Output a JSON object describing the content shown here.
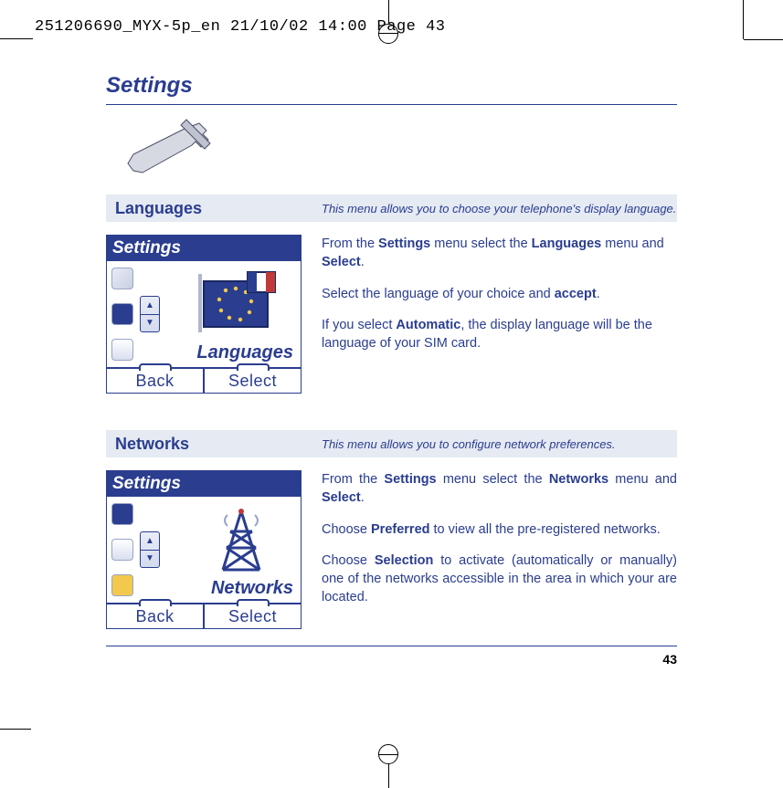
{
  "printer_line": "251206690_MYX-5p_en  21/10/02  14:00  Page 43",
  "page_title": "Settings",
  "page_number": "43",
  "sections": {
    "languages": {
      "title": "Languages",
      "description": "This menu allows you to choose your telephone's display language.",
      "phone": {
        "header": "Settings",
        "label": "Languages",
        "back": "Back",
        "select": "Select"
      },
      "body": {
        "p1a": "From the ",
        "p1b": "Settings",
        "p1c": " menu select the ",
        "p1d": "Languages",
        "p1e": " menu and ",
        "p1f": "Select",
        "p1g": ".",
        "p2a": "Select the language of your choice and ",
        "p2b": "accept",
        "p2c": ".",
        "p3a": "If you select ",
        "p3b": "Automatic",
        "p3c": ", the display language will be the language of your SIM card."
      }
    },
    "networks": {
      "title": "Networks",
      "description": "This menu allows you to configure network preferences.",
      "phone": {
        "header": "Settings",
        "label": "Networks",
        "back": "Back",
        "select": "Select"
      },
      "body": {
        "p1a": "From the ",
        "p1b": "Settings",
        "p1c": " menu select the ",
        "p1d": "Networks",
        "p1e": " menu and ",
        "p1f": "Select",
        "p1g": ".",
        "p2a": "Choose ",
        "p2b": "Preferred",
        "p2c": " to view all the pre-registered networks.",
        "p3a": "Choose ",
        "p3b": "Selection",
        "p3c": " to activate (automatically or manually) one of the networks accessible in the area in which your are located."
      }
    }
  }
}
